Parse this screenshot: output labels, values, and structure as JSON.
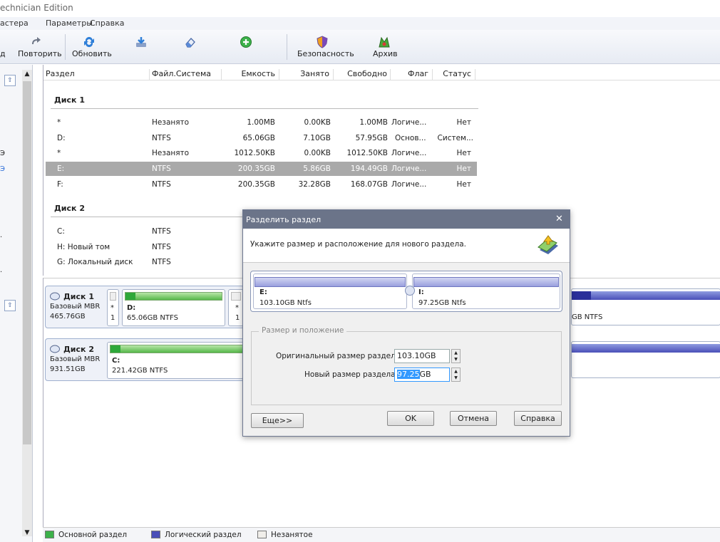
{
  "window": {
    "title": "echnician Edition"
  },
  "menu": {
    "items": [
      "астера",
      "Параметры",
      "Справка"
    ]
  },
  "toolbar": {
    "left_cut": "д",
    "repeat": "Повторить",
    "refresh": "Обновить",
    "security": "Безопасность",
    "archive": "Архив"
  },
  "table": {
    "headers": [
      "Раздел",
      "Файл.Система",
      "Емкость",
      "Занято",
      "Свободно",
      "Флаг",
      "Статус"
    ],
    "disk1_title": "Диск 1",
    "disk2_title": "Диск 2",
    "disk1_rows": [
      {
        "name": "*",
        "fs": "Незанято",
        "cap": "1.00MB",
        "used": "0.00KB",
        "free": "1.00MB",
        "flag": "Логиче...",
        "status": "Нет"
      },
      {
        "name": "D:",
        "fs": "NTFS",
        "cap": "65.06GB",
        "used": "7.10GB",
        "free": "57.95GB",
        "flag": "Основ...",
        "status": "Систем..."
      },
      {
        "name": "*",
        "fs": "Незанято",
        "cap": "1012.50KB",
        "used": "0.00KB",
        "free": "1012.50KB",
        "flag": "Логиче...",
        "status": "Нет"
      },
      {
        "name": "E:",
        "fs": "NTFS",
        "cap": "200.35GB",
        "used": "5.86GB",
        "free": "194.49GB",
        "flag": "Логиче...",
        "status": "Нет"
      },
      {
        "name": "F:",
        "fs": "NTFS",
        "cap": "200.35GB",
        "used": "32.28GB",
        "free": "168.07GB",
        "flag": "Логиче...",
        "status": "Нет"
      }
    ],
    "disk2_rows": [
      {
        "name": "C:",
        "fs": "NTFS"
      },
      {
        "name": "H: Новый том",
        "fs": "NTFS"
      },
      {
        "name": "G: Локальный диск",
        "fs": "NTFS"
      }
    ]
  },
  "diskmap": {
    "disk1": {
      "name": "Диск 1",
      "type": "Базовый MBR",
      "size": "465.76GB",
      "p_star": "*",
      "p_one": "1",
      "p_d_label": "D:",
      "p_d_info": "65.06GB NTFS",
      "p_star2": "*",
      "p_one2": "1",
      "right_info": "GB NTFS"
    },
    "disk2": {
      "name": "Диск 2",
      "type": "Базовый MBR",
      "size": "931.51GB",
      "p_c_label": "C:",
      "p_c_info": "221.42GB NTFS"
    }
  },
  "legend": {
    "primary": "Основной раздел",
    "logical": "Логический раздел",
    "unallocated": "Незанятое"
  },
  "left_panel": {
    "chars": [
      "Э",
      "Э",
      ".",
      "."
    ]
  },
  "dialog": {
    "title": "Разделить раздел",
    "instruction": "Укажите размер и расположение для нового раздела.",
    "left_part_label": "E:",
    "left_part_info": "103.10GB Ntfs",
    "right_part_label": "I:",
    "right_part_info": "97.25GB Ntfs",
    "group_title": "Размер и положение",
    "orig_label": "Оригинальный размер раздела:",
    "orig_value": "103.10GB",
    "new_label": "Новый размер раздела:",
    "new_value_sel": "97.25",
    "new_value_unit": "GB",
    "more_btn": "Еще>>",
    "ok_btn": "OK",
    "cancel_btn": "Отмена",
    "help_btn": "Справка",
    "close": "✕"
  },
  "colors": {
    "accent_blue": "#3399ff",
    "green": "#56b84a",
    "logical": "#4a4fb8",
    "selected_row": "#a9a9a9"
  }
}
